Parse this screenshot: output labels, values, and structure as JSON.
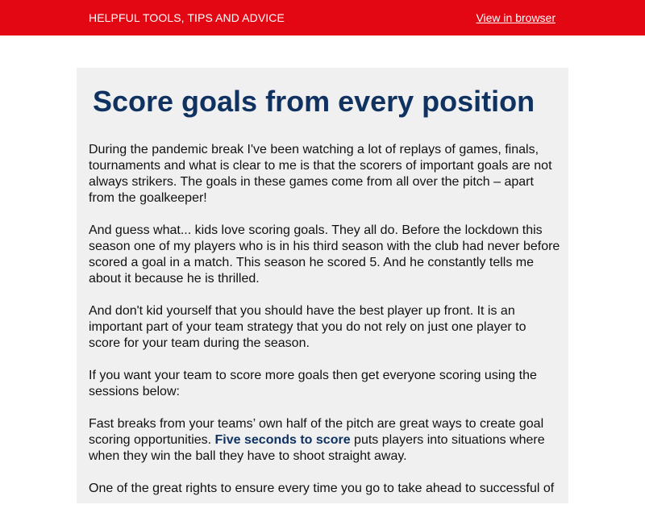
{
  "header": {
    "tagline": "HELPFUL TOOLS, TIPS AND ADVICE",
    "view_in_browser": "View in browser",
    "bg_color": "#e30613"
  },
  "article": {
    "title": "Score goals from every position",
    "title_color": "#0f3260",
    "paragraphs": [
      "During the pandemic break I've been watching a lot of replays of games, finals, tournaments and what is clear to me is that the scorers of important goals are not always strikers. The goals in these games come from all over the pitch – apart from the goalkeeper!",
      "And guess what... kids love scoring goals. They all do. Before the lockdown this season one of my players who is in his third season with the club had never before scored a goal in a match. This season he scored 5. And he constantly tells me about it because he is thrilled.",
      "And don't kid yourself that you should have the best player up front. It is an important part of your team strategy that you do not rely on just one player to score for your team during the season.",
      "If you want your team to score more goals then get everyone scoring using the sessions below:"
    ],
    "p5_before": "Fast breaks from your teams’ own half of the pitch are great ways to create goal scoring opportunities. ",
    "p5_link": "Five seconds to score",
    "p5_after": " puts players into situations where when they win the ball they have to shoot straight away.",
    "p6_partial": "One of the great rights to ensure every time you go to take ahead to successful of"
  }
}
